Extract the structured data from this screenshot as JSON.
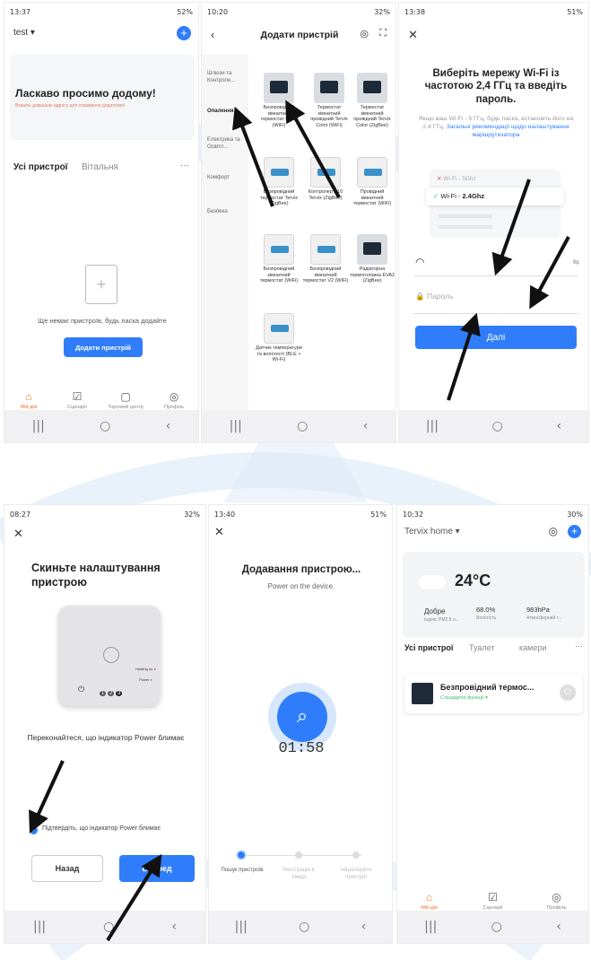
{
  "colors": {
    "accent": "#2f7dfa",
    "orange": "#f0762c",
    "watermark": "#cfe0f3"
  },
  "p1": {
    "status_time": "13:37",
    "status_right": "52%",
    "home_name": "test",
    "welcome": "Ласкаво просимо додому!",
    "welcome_sub": "Вкажіть домашню адресу для отримання додаткової",
    "tab_all": "Усі пристрої",
    "tab_room": "Вітальня",
    "empty_text": "Ще немає пристроїв, будь ласка додайте",
    "add_button": "Додати пристрій",
    "nav": [
      "Мій дім",
      "Сценарії",
      "Торговий центр",
      "Профіль"
    ]
  },
  "p2": {
    "status_time": "10:20",
    "status_right": "32%",
    "title": "Додати пристрій",
    "categories": [
      "Шлюзи та Контроле...",
      "Опалення",
      "Електрика та Освітл...",
      "Комфорт",
      "Безпека"
    ],
    "devices": [
      "Безпровідний кімнатний термостат Cube (WiFi)",
      "Термостат кімнатний провідний Tervix Color (WiFi)",
      "Термостат кімнатний провідний Tervix Color (ZigBee)",
      "Безпровідний термостат Tervix (ZigBee)",
      "Контролер X10 Tervix (ZigBee)",
      "Провідний кімнатний термостат (WiFi)",
      "Безпровідний кімнатний термостат (WiFi)",
      "Безпровідний кімнатний термостат V2 (WiFi)",
      "Радіаторна термоголовка EVA2 (ZigBee)",
      "Датчик температури та вологості (BLE + Wi-Fi)"
    ]
  },
  "p3": {
    "status_time": "13:38",
    "status_right": "51%",
    "title": "Виберіть мережу Wi-Fi із частотою 2,4 ГГц та введіть пароль.",
    "hint": "Якщо ваш Wi-Fi - 5 ГГц, будь ласка, встановіть його на 2,4 ГГц.",
    "hint_link": "Загальні рекомендації щодо налаштування маршрутизатора",
    "wifi_bad": "Wi-Fi - 5Ghz",
    "wifi_good_prefix": "Wi-Fi - ",
    "wifi_good_band": "2.4Ghz",
    "password_placeholder": "Пароль",
    "next_button": "Далі"
  },
  "p4": {
    "status_time": "08:27",
    "status_right": "32%",
    "title": "Скиньте налаштування пристрою",
    "device_heating": "Heating on",
    "device_power": "Power",
    "badges": [
      "1",
      "2",
      "3"
    ],
    "instruction": "Переконайтеся, що індикатор Power блимає",
    "confirm": "Підтвердіть, що індикатор Power блимає",
    "back_button": "Назад",
    "next_button": "Вперед"
  },
  "p5": {
    "status_time": "13:40",
    "status_right": "51%",
    "title": "Додавання пристрою...",
    "subtitle": "Power on the device.",
    "timer": "01:58",
    "steps": [
      "Пошук пристроїв",
      "Реєстрація в Хмарі",
      "Ініціалізуйте пристрій"
    ]
  },
  "p6": {
    "status_time": "10:32",
    "status_right": "30%",
    "home_name": "Tervix home",
    "temperature": "24°C",
    "air_value": "Добре",
    "air_label": "Індекс PM2.5 н...",
    "humidity_value": "68.0%",
    "humidity_label": "Вологість",
    "pressure_value": "983hPa",
    "pressure_label": "Атмосферний т...",
    "tabs": [
      "Усі пристрої",
      "Туалет",
      "камери"
    ],
    "device_name": "Безпровідний термос...",
    "device_sub": "Стандартні функції",
    "nav": [
      "Мій дім",
      "Сценарії",
      "Профіль"
    ]
  }
}
